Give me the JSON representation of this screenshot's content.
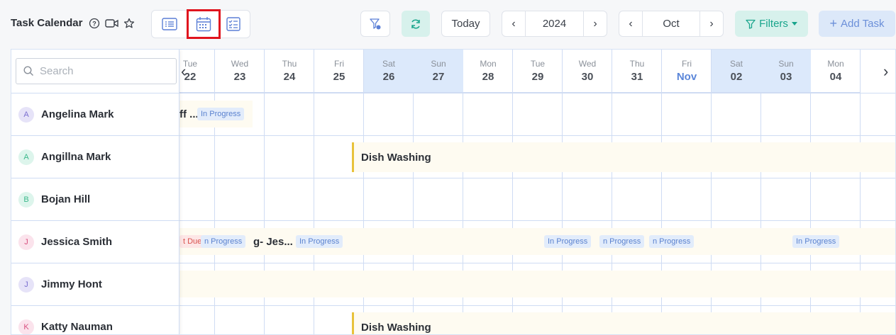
{
  "toolbar": {
    "title": "Task Calendar",
    "today_label": "Today",
    "year": "2024",
    "month": "Oct",
    "filters_label": "Filters",
    "add_task_label": "Add Task",
    "accent_color": "#19a58c",
    "primary_color": "#5b86d9",
    "highlight_color": "#e0141e"
  },
  "search": {
    "placeholder": "Search"
  },
  "days": [
    {
      "name": "Tue",
      "date": "22",
      "weekend": false
    },
    {
      "name": "Wed",
      "date": "23",
      "weekend": false
    },
    {
      "name": "Thu",
      "date": "24",
      "weekend": false
    },
    {
      "name": "Fri",
      "date": "25",
      "weekend": false
    },
    {
      "name": "Sat",
      "date": "26",
      "weekend": true
    },
    {
      "name": "Sun",
      "date": "27",
      "weekend": true
    },
    {
      "name": "Mon",
      "date": "28",
      "weekend": false
    },
    {
      "name": "Tue",
      "date": "29",
      "weekend": false
    },
    {
      "name": "Wed",
      "date": "30",
      "weekend": false
    },
    {
      "name": "Thu",
      "date": "31",
      "weekend": false
    },
    {
      "name": "Fri",
      "date": "Nov",
      "weekend": false,
      "month": true
    },
    {
      "name": "Sat",
      "date": "02",
      "weekend": true
    },
    {
      "name": "Sun",
      "date": "03",
      "weekend": true
    },
    {
      "name": "Mon",
      "date": "04",
      "weekend": false
    }
  ],
  "people": [
    {
      "initial": "A",
      "name": "Angelina Mark",
      "avatar_bg": "#e6e3f8",
      "avatar_fg": "#7b6fd0"
    },
    {
      "initial": "A",
      "name": "Angillna Mark",
      "avatar_bg": "#ddf5ec",
      "avatar_fg": "#3cb88b"
    },
    {
      "initial": "B",
      "name": "Bojan Hill",
      "avatar_bg": "#ddf5ec",
      "avatar_fg": "#3cb88b"
    },
    {
      "initial": "J",
      "name": "Jessica Smith",
      "avatar_bg": "#fbe3ec",
      "avatar_fg": "#d8507f"
    },
    {
      "initial": "J",
      "name": "Jimmy Hont",
      "avatar_bg": "#e6e3f8",
      "avatar_fg": "#7b6fd0"
    },
    {
      "initial": "K",
      "name": "Katty Nauman",
      "avatar_bg": "#fbe3ec",
      "avatar_fg": "#d8507f"
    }
  ],
  "tasks": {
    "row1_text": "ff ...",
    "row1_badge": "In Progress",
    "dish_washing_1": "Dish Washing",
    "row4_due": "t Due",
    "row4_badge_1": "n Progress",
    "row4_text": "g- Jes...",
    "row4_badge_2": "In Progress",
    "row4_badge_3": "In Progress",
    "row4_badge_4": "n Progress",
    "row4_badge_5": "n Progress",
    "row4_badge_6": "In Progress",
    "dish_washing_2": "Dish Washing"
  }
}
